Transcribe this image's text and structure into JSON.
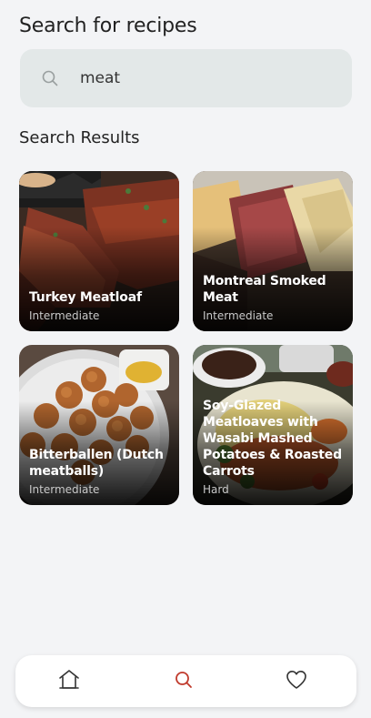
{
  "header": {
    "title": "Search for recipes"
  },
  "search": {
    "value": "meat",
    "icon": "search-icon"
  },
  "results": {
    "title": "Search Results",
    "cards": [
      {
        "name": "Turkey Meatloaf",
        "level": "Intermediate"
      },
      {
        "name": "Montreal Smoked Meat",
        "level": "Intermediate"
      },
      {
        "name": "Bitterballen (Dutch meatballs)",
        "level": "Intermediate"
      },
      {
        "name": "Soy-Glazed Meatloaves with Wasabi Mashed Potatoes & Roasted Carrots",
        "level": "Hard"
      }
    ]
  },
  "nav": {
    "items": [
      {
        "icon": "home-icon",
        "active": false
      },
      {
        "icon": "search-icon",
        "active": true
      },
      {
        "icon": "heart-icon",
        "active": false
      }
    ],
    "active_color": "#c0392b"
  },
  "colors": {
    "background": "#f3f4f6",
    "search_box": "#e3e8e8",
    "accent": "#c0392b"
  }
}
